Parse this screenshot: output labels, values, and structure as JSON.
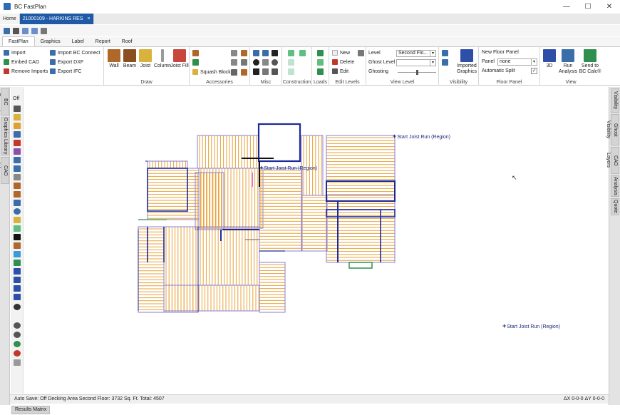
{
  "window": {
    "title": "BC FastPlan",
    "minimize": "—",
    "maximize": "☐",
    "close": "✕"
  },
  "doc_tabs": {
    "home": "Home",
    "active": "21000109 - HARKINS RES",
    "close": "×"
  },
  "ribbon_tabs": [
    "FastPlan",
    "Graphics",
    "Label",
    "Report",
    "Roof"
  ],
  "ribbon": {
    "import": {
      "import": "Import",
      "embed_cad": "Embed CAD",
      "remove_imports": "Remove Imports",
      "import_bc_connect": "Import BC Connect",
      "export_dxf": "Export DXF",
      "export_ifc": "Export IFC"
    },
    "draw": {
      "label": "Draw",
      "wall": "Wall",
      "beam": "Beam",
      "joist": "Joist",
      "column": "Column",
      "joist_fill": "Joist Fill"
    },
    "accessories": {
      "label": "Accessories",
      "squash_block": "Squash Block"
    },
    "misc": {
      "label": "Misc"
    },
    "construction": {
      "label": "Construction"
    },
    "loads": {
      "label": "Loads"
    },
    "edit_levels": {
      "label": "Edit Levels",
      "new": "New",
      "delete": "Delete",
      "edit": "Edit"
    },
    "view_level": {
      "label": "View Level",
      "level": "Level",
      "level_value": "Second Flo...",
      "ghost_level": "Ghost Level",
      "ghost_value": "",
      "ghosting": "Ghosting"
    },
    "visibility": {
      "label": "Visibility"
    },
    "imported_graphics": {
      "line1": "Imported",
      "line2": "Graphics"
    },
    "floor_panel": {
      "label": "Floor Panel",
      "new_floor_panel": "New Floor Panel",
      "panel": "Panel",
      "panel_value": "none",
      "automatic_split": "Automatic Split",
      "automatic_split_checked": "✓"
    },
    "view": {
      "label": "View",
      "3d": "3D",
      "run_analysis_1": "Run",
      "run_analysis_2": "Analysis",
      "send_1": "Send to",
      "send_2": "BC Calc®"
    }
  },
  "left_dock_tabs": [
    "BC Connect",
    "Graphics Library",
    "CAD Library"
  ],
  "right_dock_tabs": [
    "Visibility",
    "Ghost Visibility",
    "CAD Layers",
    "Analysis",
    "Quote"
  ],
  "toolbox": {
    "off": "Off"
  },
  "canvas": {
    "annotations": [
      "Start Joist Run  (Region)",
      "Start Joist Run  (Region)",
      "Start Joist Run  (Region)"
    ],
    "colors": {
      "joist": "#e8a23a",
      "beam": "#1d2a9a",
      "wall": "#8a7fd1",
      "green": "#2f8f4f"
    }
  },
  "status": {
    "left": "Auto Save: Off  Decking Area Second Floor: 3732  Sq. Ft.  Total: 4507",
    "right": "ΔX 0-0-0  ΔY 0-0-0"
  },
  "bottom_tab": "Results Matrix"
}
